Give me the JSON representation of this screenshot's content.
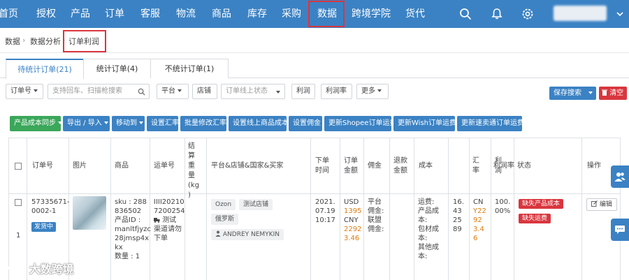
{
  "nav": {
    "items": [
      "首页",
      "授权",
      "产品",
      "订单",
      "客服",
      "物流",
      "商品",
      "库存",
      "采购",
      "数据",
      "跨境学院",
      "货代"
    ],
    "active": "数据",
    "bg_color": "#3b82c4",
    "highlight_color": "#d9363e",
    "icons": [
      "search-icon",
      "bell-icon",
      "gear-icon",
      "avatar",
      "chevron-down-icon"
    ]
  },
  "breadcrumb": [
    "数据",
    "数据分析",
    "订单利润"
  ],
  "tabs": [
    "待统计订单(21)",
    "统计订单(4)",
    "不统计订单(1)"
  ],
  "filters": {
    "order_no": "订单号",
    "search_placeholder": "支持回车、扫描枪搜索",
    "platform": "平台",
    "store": "店铺",
    "online_status": "订单线上状态",
    "profit": "利润",
    "profit_rate": "利润率",
    "more": "更多",
    "save_search": "保存搜索",
    "clear": "清空"
  },
  "actions": [
    "产品成本同步",
    "导出 / 导入",
    "移动到",
    "设置汇率",
    "批量修改汇率",
    "设置线上商品成本",
    "设置佣金",
    "更新Shopee订单运费",
    "更新Wish订单运费",
    "更新速卖通订单运费"
  ],
  "table": {
    "headers": {
      "order_no": "订单号",
      "image": "图片",
      "product": "商品",
      "waybill": "运单号",
      "weight": [
        "结",
        "算",
        "重",
        "量",
        "(kg",
        ")"
      ],
      "platform_store": "平台&店铺&国家&买家",
      "order_time": [
        "下单",
        "时间"
      ],
      "order_amount": [
        "订单",
        "金额"
      ],
      "commission": "佣金",
      "refund_amount": [
        "退款",
        "金额"
      ],
      "cost": "成本",
      "exchange_rate": [
        "汇",
        "率"
      ],
      "profit": [
        "利",
        "润"
      ],
      "profit_rate": "利润率",
      "status": "状态",
      "operation": "操作"
    },
    "row": {
      "order_no": [
        "57335671-",
        "0002-1"
      ],
      "ship_badge": "发货中",
      "row_index": "1",
      "product": [
        "sku : 288",
        "836502",
        "产品ID :",
        "manltfjyzc",
        "28jmsp4x",
        "kx",
        "数量 : 1"
      ],
      "waybill": [
        "IIII20210",
        "7200254"
      ],
      "waybill_sub": [
        "测试",
        "渠道请勿",
        "下单"
      ],
      "platform": "Ozon",
      "store": "测试店铺",
      "country": "俄罗斯",
      "buyer": "ANDREY NEMYKIN",
      "order_time": [
        "2021.",
        "07.19",
        "10:17"
      ],
      "amount_usd_label": "USD",
      "amount_usd": "1395",
      "amount_cny_label": "CNY",
      "amount_cny": [
        "2292",
        "3.46"
      ],
      "commission": [
        "平台",
        "佣金:",
        "联盟",
        "佣金:"
      ],
      "cost": [
        "运费:",
        "产品成",
        "本:",
        "包材成",
        "本:",
        "其他成",
        "本:"
      ],
      "exchange_rate": [
        "16.",
        "43",
        "25",
        "89"
      ],
      "profit_label": "CN",
      "profit": [
        "Y22",
        "92",
        "3.4",
        "6"
      ],
      "profit_rate": [
        "100.",
        "00%"
      ],
      "status": [
        "缺失产品成本",
        "缺失运费"
      ],
      "edit": "编辑"
    }
  },
  "watermark": "大数跨境"
}
